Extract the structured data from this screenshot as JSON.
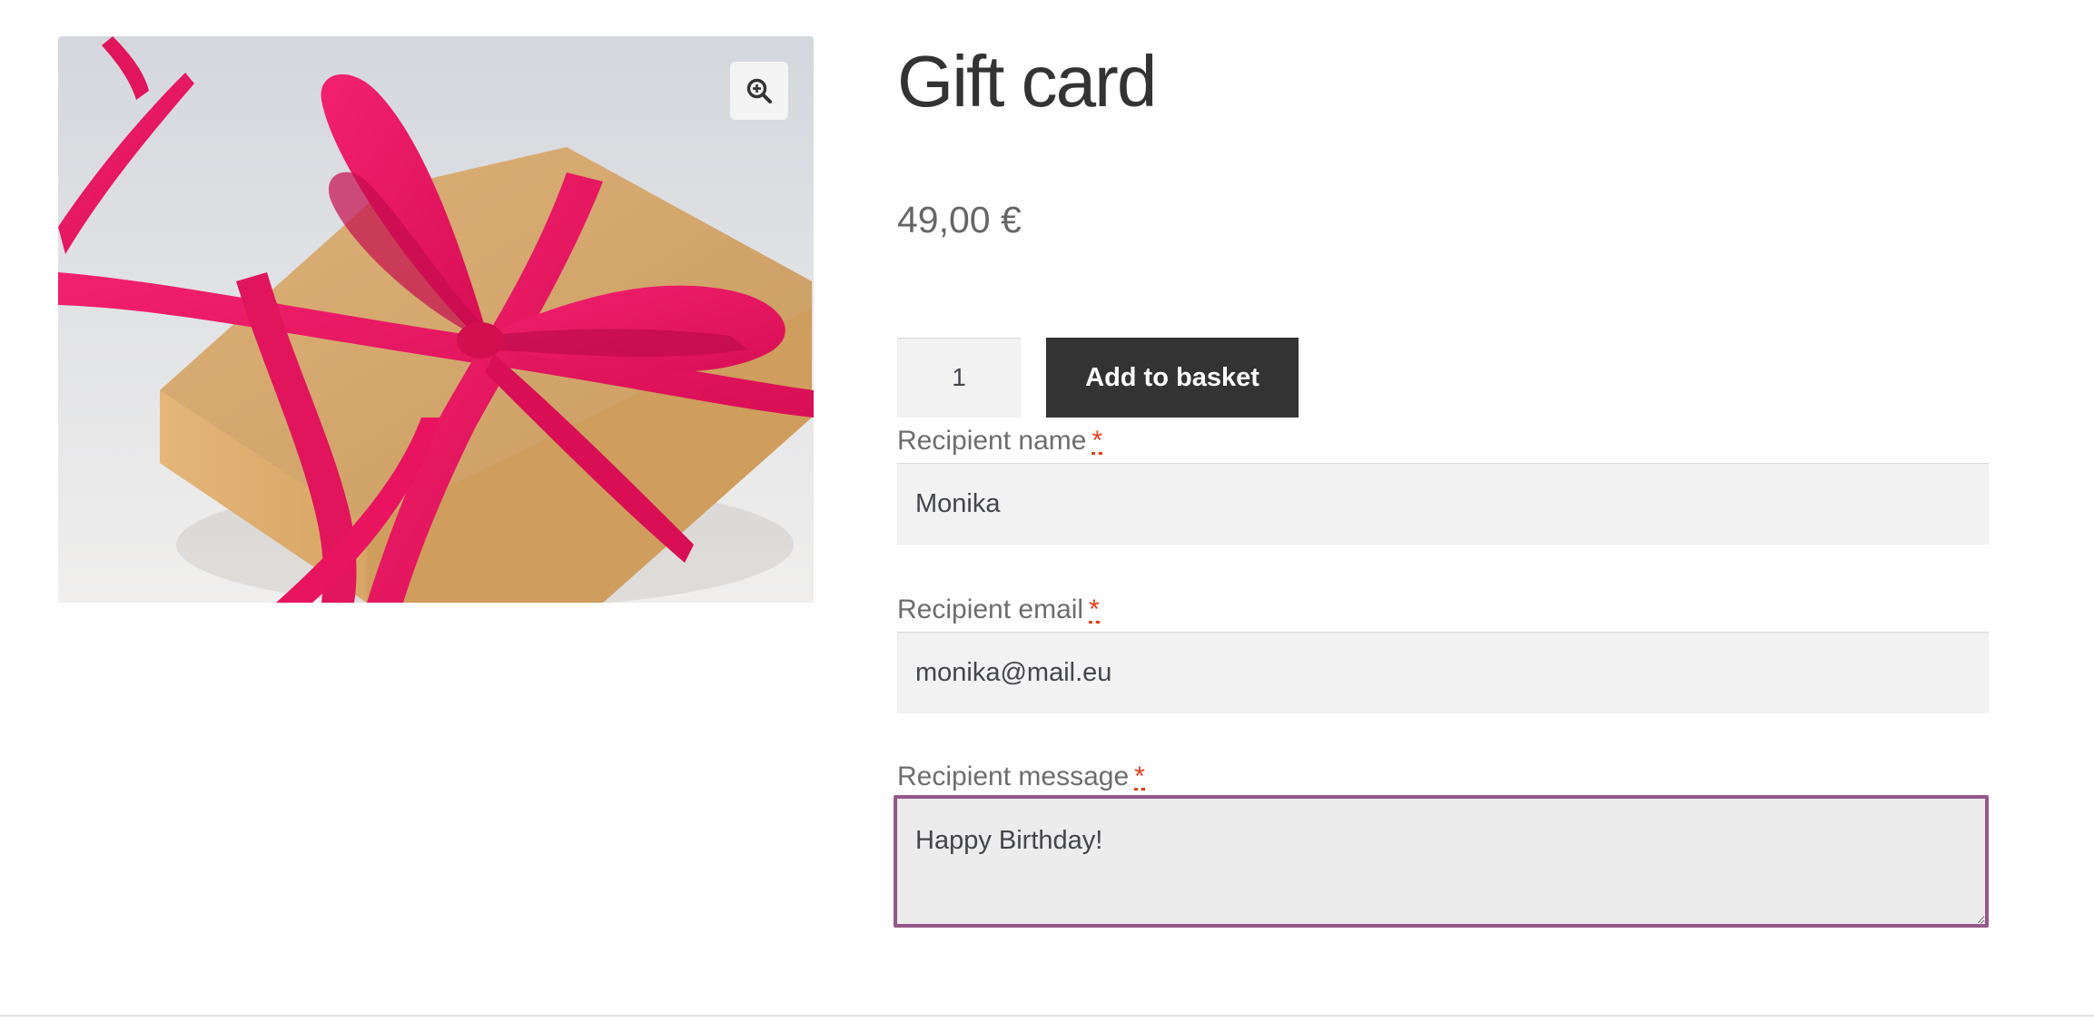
{
  "product": {
    "title": "Gift card",
    "price": "49,00 €",
    "image_alt": "Gift box wrapped in brown paper with pink ribbon"
  },
  "cart": {
    "quantity": "1",
    "add_label": "Add to basket"
  },
  "form": {
    "recipient_name": {
      "label": "Recipient name",
      "required_mark": "*",
      "value": "Monika"
    },
    "recipient_email": {
      "label": "Recipient email",
      "required_mark": "*",
      "value": "monika@mail.eu"
    },
    "recipient_message": {
      "label": "Recipient message",
      "required_mark": "*",
      "value": "Happy Birthday!"
    }
  },
  "icons": {
    "zoom": "zoom-in-magnifier-icon"
  },
  "colors": {
    "button_bg": "#333333",
    "focus_border": "#96588a",
    "required": "#e2401c",
    "input_bg": "#f2f2f2",
    "ribbon": "#e8145f",
    "box_paper": "#d3a56c"
  }
}
